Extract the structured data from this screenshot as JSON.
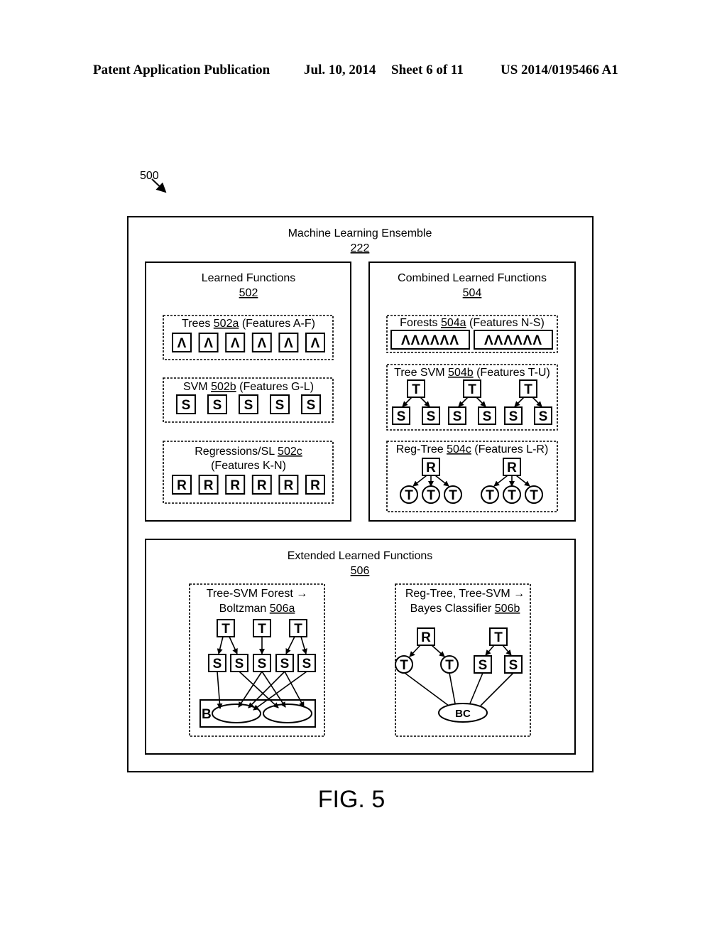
{
  "header": {
    "publication": "Patent Application Publication",
    "date": "Jul. 10, 2014",
    "sheet": "Sheet 6 of 11",
    "number": "US 2014/0195466 A1"
  },
  "figure_ref": "500",
  "ensemble": {
    "title": "Machine Learning Ensemble",
    "ref": "222"
  },
  "learned": {
    "title": "Learned Functions",
    "ref": "502",
    "trees": {
      "pre": "Trees ",
      "ref": "502a",
      "post": " (Features A-F)",
      "node": "Λ",
      "count": 6
    },
    "svm": {
      "pre": "SVM ",
      "ref": "502b",
      "post": " (Features G-L)",
      "node": "S",
      "count": 5
    },
    "regressions": {
      "pre": "Regressions/SL ",
      "ref": "502c",
      "line2": "(Features K-N)",
      "node": "R",
      "count": 6
    }
  },
  "combined": {
    "title": "Combined Learned Functions",
    "ref": "504",
    "forests": {
      "pre": "Forests ",
      "ref": "504a",
      "post": " (Features N-S)",
      "group": "ΛΛΛΛΛΛ",
      "count": 2
    },
    "tree_svm": {
      "pre": "Tree SVM ",
      "ref": "504b",
      "post": " (Features T-U)",
      "parent": "T",
      "child": "S",
      "count": 3
    },
    "reg_tree": {
      "pre": "Reg-Tree ",
      "ref": "504c",
      "post": " (Features L-R)",
      "parent": "R",
      "child": "T",
      "count": 2
    }
  },
  "extended": {
    "title": "Extended Learned Functions",
    "ref": "506",
    "boltzman": {
      "line1": "Tree-SVM Forest →",
      "pre2": "Boltzman ",
      "ref": "506a",
      "parent": "T",
      "child": "S",
      "machine": "B"
    },
    "bayes": {
      "line1": "Reg-Tree, Tree-SVM →",
      "pre2": "Bayes Classifier ",
      "ref": "506b",
      "r": "R",
      "t": "T",
      "s": "S",
      "classifier": "BC"
    }
  },
  "caption": "FIG. 5"
}
